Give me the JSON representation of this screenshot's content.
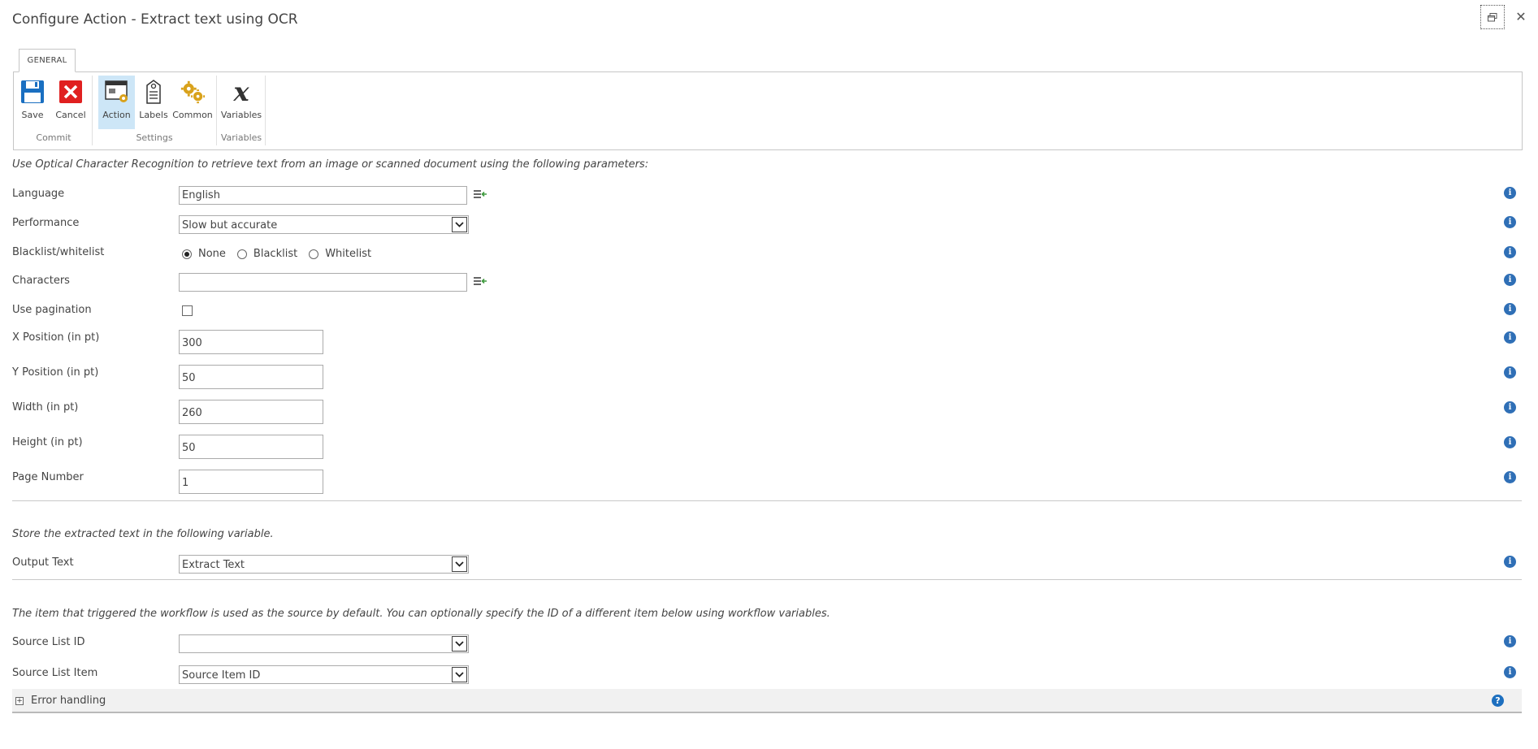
{
  "window": {
    "title": "Configure Action - Extract text using OCR"
  },
  "ribbon": {
    "tab": "GENERAL",
    "buttons": {
      "save": "Save",
      "cancel": "Cancel",
      "action": "Action",
      "labels": "Labels",
      "common": "Common",
      "variables": "Variables"
    },
    "groups": {
      "commit": "Commit",
      "settings": "Settings",
      "variables": "Variables"
    }
  },
  "form": {
    "intro": "Use Optical Character Recognition to retrieve text from an image or scanned document using the following parameters:",
    "language": {
      "label": "Language",
      "value": "English"
    },
    "performance": {
      "label": "Performance",
      "value": "Slow but accurate"
    },
    "list_mode": {
      "label": "Blacklist/whitelist",
      "options": [
        "None",
        "Blacklist",
        "Whitelist"
      ],
      "selected": "None"
    },
    "characters": {
      "label": "Characters",
      "value": ""
    },
    "use_pagination": {
      "label": "Use pagination",
      "checked": false
    },
    "x_position": {
      "label": "X Position (in pt)",
      "value": "300"
    },
    "y_position": {
      "label": "Y Position (in pt)",
      "value": "50"
    },
    "width": {
      "label": "Width (in pt)",
      "value": "260"
    },
    "height": {
      "label": "Height (in pt)",
      "value": "50"
    },
    "page_number": {
      "label": "Page Number",
      "value": "1"
    },
    "store_intro": "Store the extracted text in the following variable.",
    "output_text": {
      "label": "Output Text",
      "value": "Extract Text"
    },
    "source_intro": "The item that triggered the workflow is used as the source by default. You can optionally specify the ID of a different item below using workflow variables.",
    "source_list_id": {
      "label": "Source List ID",
      "value": ""
    },
    "source_list_item": {
      "label": "Source List Item",
      "value": "Source Item ID"
    },
    "error_handling": {
      "label": "Error handling",
      "expand_symbol": "+"
    }
  },
  "icons": {
    "info": "i",
    "help": "?",
    "close": "✕"
  },
  "colors": {
    "info_blue": "#2f6fb6",
    "selected_button_bg": "#cde6f7",
    "save_blue": "#1a6fc1",
    "cancel_red": "#e02020",
    "gear_gold": "#d9a21b",
    "picker_green": "#3f9a3f"
  }
}
